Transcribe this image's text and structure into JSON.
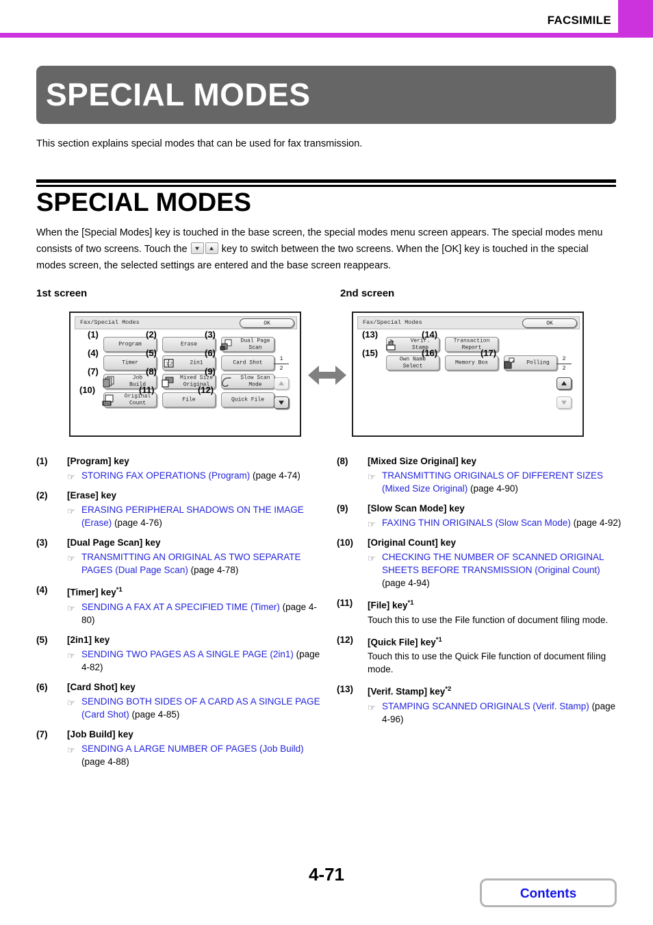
{
  "header": {
    "title": "FACSIMILE",
    "tab_color": "#cc33dd"
  },
  "chapter_banner": {
    "title": "SPECIAL MODES",
    "background": "#666666"
  },
  "intro_text": "This section explains special modes that can be used for fax transmission.",
  "section": {
    "title": "SPECIAL MODES",
    "body_part1": "When the [Special Modes] key is touched in the base screen, the special modes menu screen appears. The special modes menu consists of two screens. Touch the",
    "body_part2": "key to switch between the two screens. When the [OK] key is touched in the special modes screen, the selected settings are entered and the base screen reappears."
  },
  "screens": {
    "first_label": "1st screen",
    "second_label": "2nd screen",
    "panel_title": "Fax/Special Modes",
    "ok_label": "OK",
    "first": {
      "page_current": "1",
      "page_total": "2",
      "scroll_up_state": "inactive",
      "scroll_down_state": "active",
      "keys": [
        {
          "num": "(1)",
          "label": "Program",
          "icon": null
        },
        {
          "num": "(2)",
          "label": "Erase",
          "icon": null
        },
        {
          "num": "(3)",
          "label": "Dual Page\nScan",
          "icon": "dual-page-scan-icon"
        },
        {
          "num": "(4)",
          "label": "Timer",
          "icon": null
        },
        {
          "num": "(5)",
          "label": "2in1",
          "icon": "two-in-one-icon"
        },
        {
          "num": "(6)",
          "label": "Card Shot",
          "icon": null
        },
        {
          "num": "(7)",
          "label": "Job\nBuild",
          "icon": "job-build-icon"
        },
        {
          "num": "(8)",
          "label": "Mixed Size\nOriginal",
          "icon": "mixed-size-original-icon"
        },
        {
          "num": "(9)",
          "label": "Slow Scan\nMode",
          "icon": "slow-scan-mode-icon"
        },
        {
          "num": "(10)",
          "label": "Original\nCount",
          "icon": "original-count-icon"
        },
        {
          "num": "(11)",
          "label": "File",
          "icon": null
        },
        {
          "num": "(12)",
          "label": "Quick File",
          "icon": null
        }
      ]
    },
    "second": {
      "page_current": "2",
      "page_total": "2",
      "scroll_up_state": "active",
      "scroll_down_state": "inactive",
      "keys": [
        {
          "num": "(13)",
          "label": "Verif.\nStamp",
          "icon": "verif-stamp-icon"
        },
        {
          "num": "(14)",
          "label": "Transaction\nReport",
          "icon": null
        },
        {
          "num": "(15)",
          "label": "Own Name\nSelect",
          "icon": null
        },
        {
          "num": "(16)",
          "label": "Memory Box",
          "icon": null
        },
        {
          "num": "(17)",
          "label": "Polling",
          "icon": "polling-icon"
        }
      ]
    }
  },
  "items_left": [
    {
      "num": "(1)",
      "name": "[Program] key",
      "sup": "",
      "ref_link": "STORING FAX OPERATIONS (Program)",
      "ref_page": " (page 4-74)"
    },
    {
      "num": "(2)",
      "name": "[Erase] key",
      "sup": "",
      "ref_link": "ERASING PERIPHERAL SHADOWS ON THE IMAGE (Erase)",
      "ref_page": " (page 4-76)"
    },
    {
      "num": "(3)",
      "name": "[Dual Page Scan] key",
      "sup": "",
      "ref_link": "TRANSMITTING AN ORIGINAL AS TWO SEPARATE PAGES (Dual Page Scan)",
      "ref_page": " (page 4-78)"
    },
    {
      "num": "(4)",
      "name": "[Timer] key",
      "sup": "*1",
      "ref_link": "SENDING A FAX AT A SPECIFIED TIME (Timer)",
      "ref_page": " (page 4-80)"
    },
    {
      "num": "(5)",
      "name": "[2in1] key",
      "sup": "",
      "ref_link": "SENDING TWO PAGES AS A SINGLE PAGE (2in1)",
      "ref_page": " (page 4-82)"
    },
    {
      "num": "(6)",
      "name": "[Card Shot] key",
      "sup": "",
      "ref_link": "SENDING BOTH SIDES OF A CARD AS A SINGLE PAGE (Card Shot)",
      "ref_page": " (page 4-85)"
    },
    {
      "num": "(7)",
      "name": "[Job Build] key",
      "sup": "",
      "ref_link": "SENDING A LARGE NUMBER OF PAGES (Job Build)",
      "ref_page": " (page 4-88)"
    }
  ],
  "items_right": [
    {
      "num": "(8)",
      "name": "[Mixed Size Original] key",
      "sup": "",
      "ref_link": "TRANSMITTING ORIGINALS OF DIFFERENT SIZES (Mixed Size Original)",
      "ref_page": " (page 4-90)"
    },
    {
      "num": "(9)",
      "name": "[Slow Scan Mode] key",
      "sup": "",
      "ref_link": "FAXING THIN ORIGINALS (Slow Scan Mode)",
      "ref_page": " (page 4-92)"
    },
    {
      "num": "(10)",
      "name": "[Original Count] key",
      "sup": "",
      "ref_link": "CHECKING THE NUMBER OF SCANNED ORIGINAL SHEETS BEFORE TRANSMISSION (Original Count)",
      "ref_page": " (page 4-94)"
    },
    {
      "num": "(11)",
      "name": "[File] key",
      "sup": "*1",
      "plain": "Touch this to use the File function of document filing mode."
    },
    {
      "num": "(12)",
      "name": "[Quick File] key",
      "sup": "*1",
      "plain": "Touch this to use the Quick File function of document filing mode."
    },
    {
      "num": "(13)",
      "name": "[Verif. Stamp] key",
      "sup": "*2",
      "ref_link": "STAMPING SCANNED ORIGINALS (Verif. Stamp)",
      "ref_page": " (page 4-96)"
    }
  ],
  "footer": {
    "page_number": "4-71",
    "contents_label": "Contents"
  }
}
